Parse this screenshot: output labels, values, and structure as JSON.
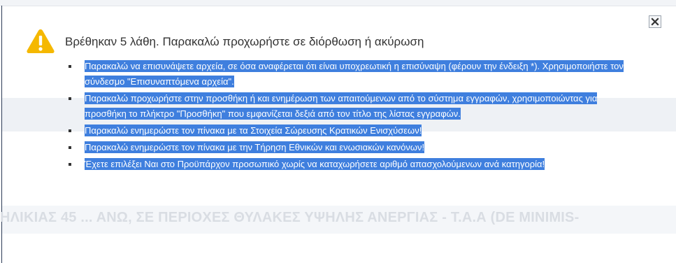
{
  "dialog": {
    "message": "Βρέθηκαν 5 λάθη. Παρακαλώ προχωρήστε σε διόρθωση ή ακύρωση",
    "close_icon": "close-icon",
    "warning_icon": "warning-icon",
    "errors": [
      "Παρακαλώ να επισυνάψετε αρχεία, σε όσα αναφέρεται ότι είναι υποχρεωτική η επισύναψη (φέρουν την ένδειξη *). Χρησιμοποιήστε τον σύνδεσμο \"Επισυναπτόμενα αρχεία\".",
      "Παρακαλώ προχωρήστε στην προσθήκη ή και ενημέρωση των απαιτούμενων από το σύστημα εγγραφών, χρησιμοποιώντας για προσθήκη το πλήκτρο \"Προσθήκη\" που εμφανίζεται δεξιά από τον τίτλο της λίστας εγγραφών.",
      "Παρακαλώ ενημερώστε τον πίνακα με τα Στοιχεία Σώρευσης Κρατικών Ενισχύσεων!",
      "Παρακαλώ ενημερώστε τον πίνακα με την Τήρηση Εθνικών και ενωσιακών κανόνων!",
      "Έχετε επιλέξει Ναι στο Προϋπάρχον προσωπικό χωρίς να καταχωρήσετε αριθμό απασχολούμενων ανά κατηγορία!"
    ]
  },
  "background": {
    "title_fragment": "ΗΛΙΚΙΑΣ 45 ... ΑΝΩ, ΣΕ ΠΕΡΙΟΧΕΣ ΘΥΛΑΚΕΣ ΥΨΗΛΗΣ ΑΝΕΡΓΙΑΣ - Τ.Α.Α (DE MINIMIS-"
  },
  "colors": {
    "selection": "#3f7fde",
    "warning": "#f5b800"
  }
}
